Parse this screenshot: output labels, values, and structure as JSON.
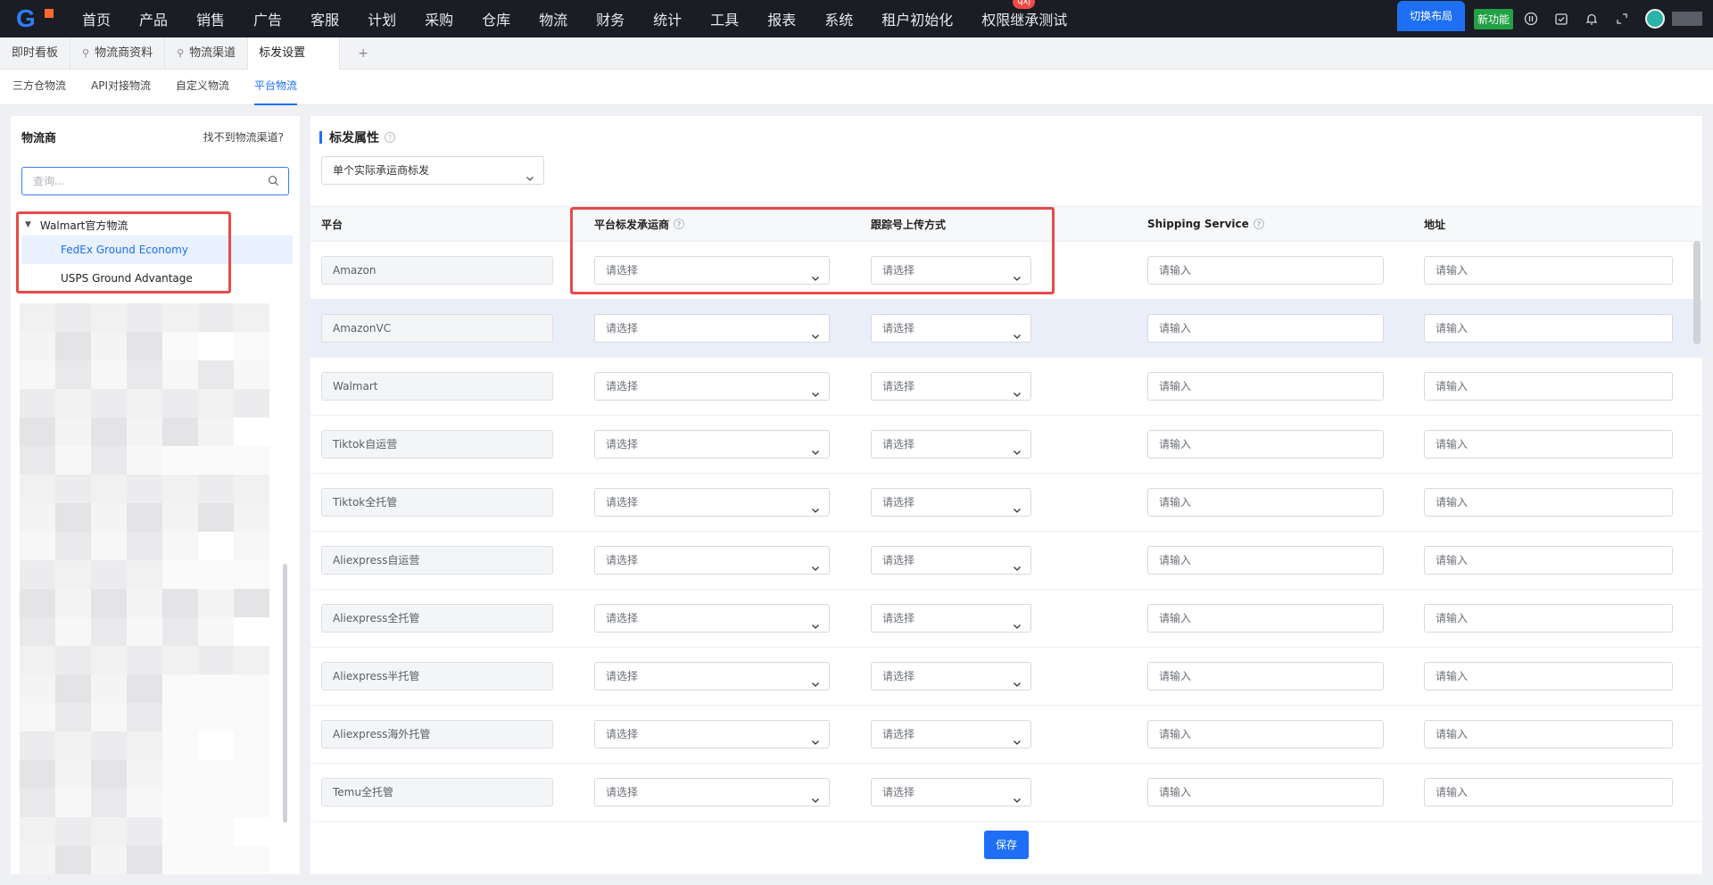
{
  "topnav": {
    "items": [
      "首页",
      "产品",
      "销售",
      "广告",
      "客服",
      "计划",
      "采购",
      "仓库",
      "物流",
      "财务",
      "统计",
      "工具",
      "报表",
      "系统",
      "租户初始化",
      "权限继承测试"
    ],
    "badge": "qxj",
    "switch_layout": "切换布局",
    "new_feature": "新功能"
  },
  "tabs": {
    "items": [
      {
        "label": "即时看板",
        "pinned": false
      },
      {
        "label": "物流商资料",
        "pinned": true
      },
      {
        "label": "物流渠道",
        "pinned": true
      },
      {
        "label": "标发设置",
        "pinned": false,
        "active": true
      }
    ],
    "add": "+"
  },
  "subtabs": {
    "items": [
      "三方仓物流",
      "API对接物流",
      "自定义物流",
      "平台物流"
    ],
    "active": "平台物流"
  },
  "left": {
    "title": "物流商",
    "link": "找不到物流渠道?",
    "search_placeholder": "查询...",
    "tree": {
      "parent": "Walmart官方物流",
      "children": [
        "FedEx Ground Economy",
        "USPS Ground Advantage"
      ],
      "selected": "FedEx Ground Economy"
    }
  },
  "right": {
    "section_title": "标发属性",
    "mode_select": "单个实际承运商标发",
    "columns": [
      "平台",
      "平台标发承运商",
      "跟踪号上传方式",
      "Shipping Service",
      "地址"
    ],
    "select_placeholder": "请选择",
    "input_placeholder": "请输入",
    "rows": [
      "Amazon",
      "AmazonVC",
      "Walmart",
      "Tiktok自运营",
      "Tiktok全托管",
      "Aliexpress自运营",
      "Aliexpress全托管",
      "Aliexpress半托管",
      "Aliexpress海外托管",
      "Temu全托管"
    ],
    "highlighted_row": "AmazonVC",
    "save": "保存"
  },
  "colors": {
    "accent": "#1e6ff5",
    "topbar": "#1a1d23",
    "annotation_red": "#e84a4a"
  }
}
